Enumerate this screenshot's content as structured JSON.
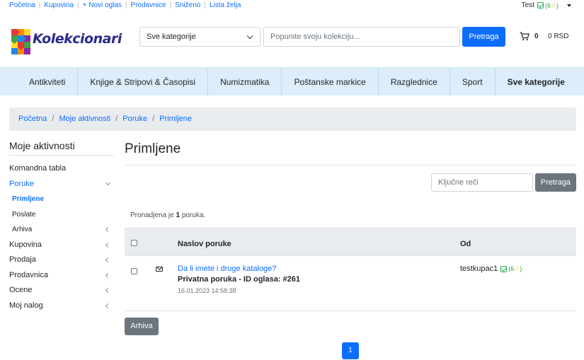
{
  "topbar": {
    "links": [
      "Početna",
      "Kupovina",
      "+ Novi oglas",
      "Prodavnice",
      "Sniženo",
      "Lista želja"
    ],
    "user_name": "Test",
    "user_rating": "(6",
    "user_rating_end": ")"
  },
  "header": {
    "logo_text": "Kolekcionari",
    "category_select": "Sve kategorije",
    "search_placeholder": "Popunite svoju kolekciju...",
    "search_button": "Pretraga",
    "cart_count": "0",
    "cart_total": "0 RSD"
  },
  "category_nav": [
    "Antikviteti",
    "Knjige & Stripovi & Časopisi",
    "Numizmatika",
    "Poštanske markice",
    "Razglednice",
    "Sport",
    "Sve kategorije"
  ],
  "breadcrumb": [
    "Početna",
    "Moje aktivnosti",
    "Poruke",
    "Primljene"
  ],
  "sidebar": {
    "title": "Moje aktivnosti",
    "items": [
      {
        "label": "Komandna tabla"
      },
      {
        "label": "Poruke"
      },
      {
        "label": "Primljene"
      },
      {
        "label": "Poslate"
      },
      {
        "label": "Arhiva"
      },
      {
        "label": "Kupovina"
      },
      {
        "label": "Prodaja"
      },
      {
        "label": "Prodavnica"
      },
      {
        "label": "Ocene"
      },
      {
        "label": "Moj nalog"
      }
    ]
  },
  "main": {
    "title": "Primljene",
    "keywords_placeholder": "Ključne reči",
    "search_button": "Pretraga",
    "found_prefix": "Pronadjena je",
    "found_count": "1",
    "found_suffix": "poruka.",
    "table_headers": {
      "subject": "Naslov poruke",
      "from": "Od"
    },
    "messages": [
      {
        "subject": "Da li imete i druge kataloge?",
        "private_note": "Privatna poruka - ID oglasa: #261",
        "date": "16.01.2023 14:58:38",
        "from_user": "testkupac1",
        "from_rating": "(6",
        "from_rating_end": ")"
      }
    ],
    "archive_button": "Arhiva",
    "current_page": "1"
  },
  "colors": {
    "accent": "#0d6efd",
    "nav_bg": "#ddedf9",
    "verified": "#28a745",
    "star": "#f0c20a"
  }
}
